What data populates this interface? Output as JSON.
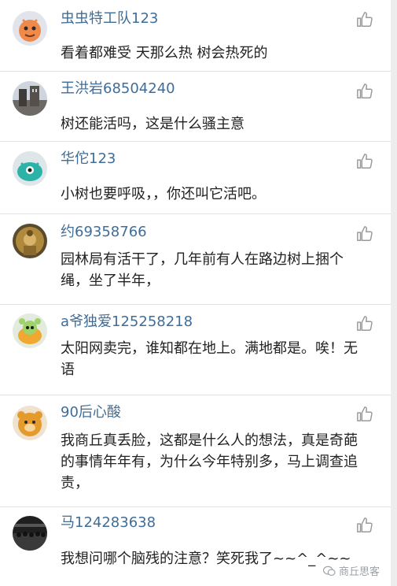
{
  "comments": [
    {
      "username": "虫虫特工队123",
      "text": "看着都难受 天那么热 树会热死的",
      "avatar": "orange-cartoon-avatar"
    },
    {
      "username": "王洪岩68504240",
      "text": "树还能活吗，这是什么骚主意",
      "avatar": "building-photo-avatar"
    },
    {
      "username": "华佗123",
      "text": "小树也要呼吸，，你还叫它活吧。",
      "avatar": "teal-monster-avatar"
    },
    {
      "username": "约69358766",
      "text": "园林局有活干了，几年前有人在路边树上捆个绳，坐了半年，",
      "avatar": "buddha-statue-avatar"
    },
    {
      "username": "a爷独爱125258218",
      "text": "太阳网卖完，谁知都在地上。满地都是。唉！无语",
      "avatar": "green-alien-avatar"
    },
    {
      "username": "90后心酸",
      "text": "我商丘真丢脸，这都是什么人的想法，真是奇葩的事情年年有，为什么今年特别多，马上调查追责，",
      "avatar": "orange-bear-avatar"
    },
    {
      "username": "马124283638",
      "text": "我想问哪个脑残的注意？笑死我了~~^_^~~",
      "avatar": "group-photo-avatar"
    }
  ],
  "watermark": "商丘思客",
  "colors": {
    "username": "#3f6d9a",
    "text": "#222222",
    "divider": "#e2e2e2",
    "icon": "#9a9a9a"
  }
}
